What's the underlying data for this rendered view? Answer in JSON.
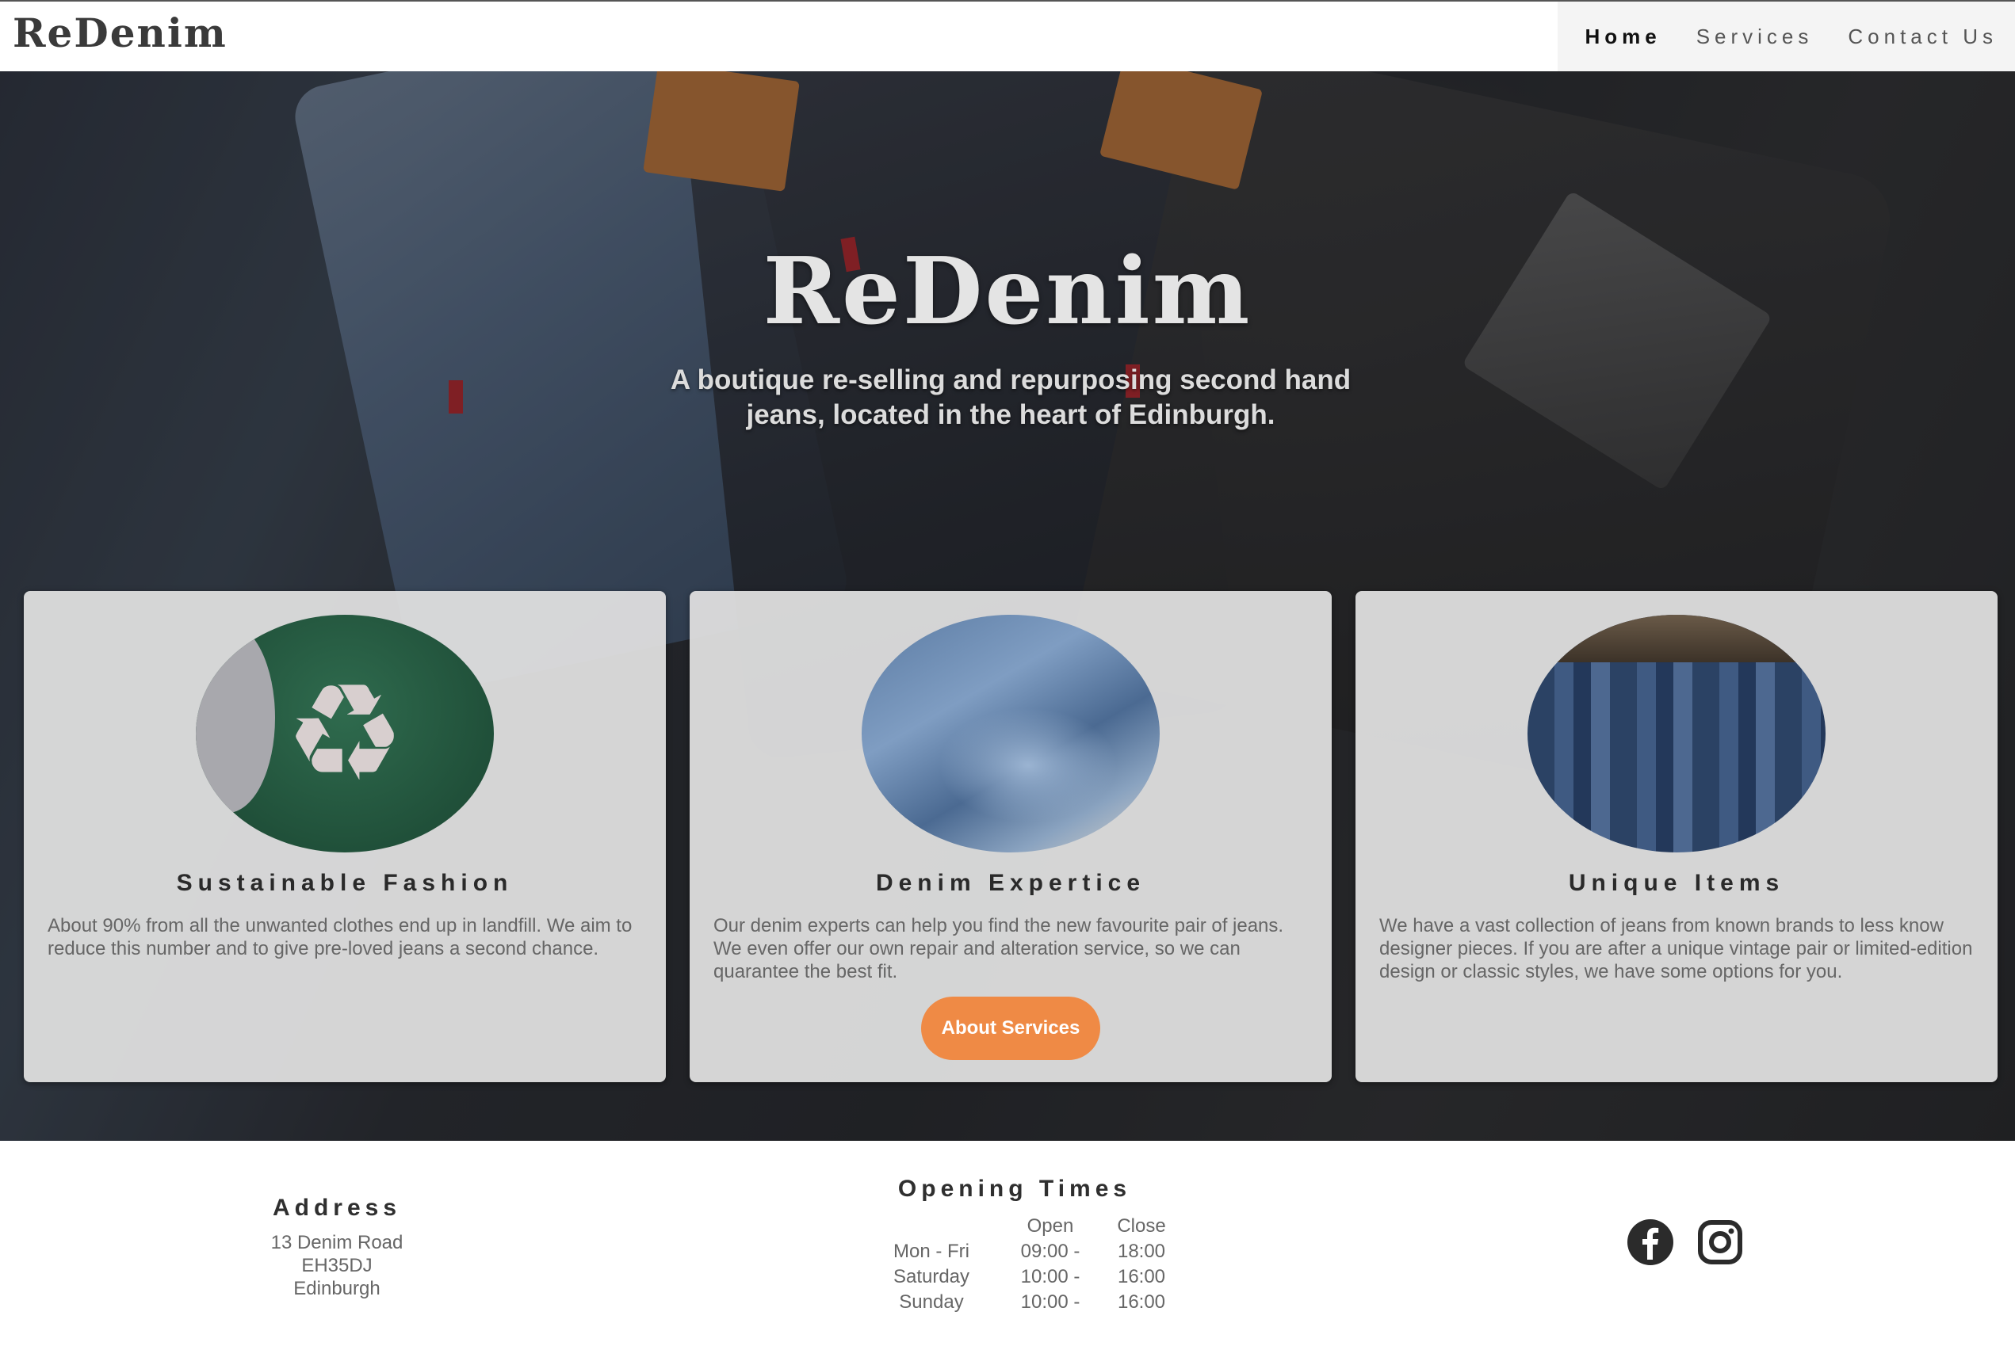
{
  "brand": {
    "logo": "ReDenim"
  },
  "nav": {
    "items": [
      {
        "label": "Home",
        "active": true
      },
      {
        "label": "Services",
        "active": false
      },
      {
        "label": "Contact Us",
        "active": false
      }
    ]
  },
  "hero": {
    "title": "ReDenim",
    "subtitle": "A boutique re-selling and repurposing second hand jeans, located in the heart of Edinburgh."
  },
  "cards": [
    {
      "image": "recycle-icon",
      "title": "Sustainable Fashion",
      "text": "About 90% from all the unwanted clothes end up in landfill. We aim to reduce this number and to give pre-loved jeans a second chance."
    },
    {
      "image": "folded-jeans",
      "title": "Denim Expertice",
      "text": "Our denim experts can help you find the new favourite pair of jeans. We even offer our own repair and alteration service, so we can quarantee the best fit.",
      "button": "About Services"
    },
    {
      "image": "jeans-rack",
      "title": "Unique Items",
      "text": "We have a vast collection of jeans from known brands to less know designer pieces. If you are after a unique vintage pair or limited-edition design or classic styles, we have some options for you."
    }
  ],
  "footer": {
    "address": {
      "heading": "Address",
      "lines": [
        "13 Denim Road",
        "EH35DJ",
        "Edinburgh"
      ]
    },
    "opening_times": {
      "heading": "Opening Times",
      "col_open": "Open",
      "col_close": "Close",
      "rows": [
        {
          "day": "Mon - Fri",
          "open": "09:00 -",
          "close": "18:00"
        },
        {
          "day": "Saturday",
          "open": "10:00 -",
          "close": "16:00"
        },
        {
          "day": "Sunday",
          "open": "10:00 -",
          "close": "16:00"
        }
      ]
    },
    "social": [
      "facebook-icon",
      "instagram-icon"
    ]
  },
  "colors": {
    "accent": "#ef8a45",
    "card_bg": "#e0e0e0",
    "text_dark": "#2a2a2a",
    "text_muted": "#666666"
  }
}
